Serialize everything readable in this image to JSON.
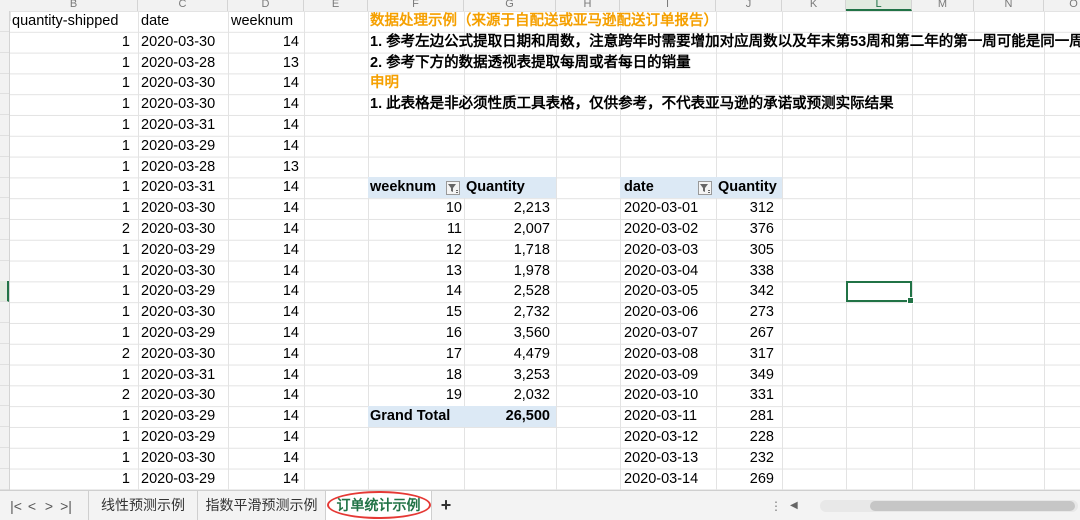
{
  "columns": [
    "B",
    "C",
    "D",
    "E",
    "F",
    "G",
    "H",
    "I",
    "J",
    "K",
    "L",
    "M",
    "N",
    "O"
  ],
  "selected_column": "L",
  "source_table": {
    "headers": [
      "quantity-shipped",
      "date",
      "weeknum"
    ],
    "rows": [
      [
        "1",
        "2020-03-30",
        "14"
      ],
      [
        "1",
        "2020-03-28",
        "13"
      ],
      [
        "1",
        "2020-03-30",
        "14"
      ],
      [
        "1",
        "2020-03-30",
        "14"
      ],
      [
        "1",
        "2020-03-31",
        "14"
      ],
      [
        "1",
        "2020-03-29",
        "14"
      ],
      [
        "1",
        "2020-03-28",
        "13"
      ],
      [
        "1",
        "2020-03-31",
        "14"
      ],
      [
        "1",
        "2020-03-30",
        "14"
      ],
      [
        "2",
        "2020-03-30",
        "14"
      ],
      [
        "1",
        "2020-03-29",
        "14"
      ],
      [
        "1",
        "2020-03-30",
        "14"
      ],
      [
        "1",
        "2020-03-29",
        "14"
      ],
      [
        "1",
        "2020-03-30",
        "14"
      ],
      [
        "1",
        "2020-03-29",
        "14"
      ],
      [
        "2",
        "2020-03-30",
        "14"
      ],
      [
        "1",
        "2020-03-31",
        "14"
      ],
      [
        "2",
        "2020-03-30",
        "14"
      ],
      [
        "1",
        "2020-03-29",
        "14"
      ],
      [
        "1",
        "2020-03-29",
        "14"
      ],
      [
        "1",
        "2020-03-30",
        "14"
      ],
      [
        "1",
        "2020-03-29",
        "14"
      ]
    ]
  },
  "notes": {
    "title": "数据处理示例（来源于自配送或亚马逊配送订单报告）",
    "line1": "1. 参考左边公式提取日期和周数，注意跨年时需要增加对应周数以及年末第53周和第二年的第一周可能是同一周",
    "line2": "2. 参考下方的数据透视表提取每周或者每日的销量",
    "disclaimer_title": "申明",
    "disclaimer_line1": "1. 此表格是非必须性质工具表格，仅供参考，不代表亚马逊的承诺或预测实际结果"
  },
  "pivot_week": {
    "headers": [
      "weeknum",
      "Quantity"
    ],
    "rows": [
      [
        "10",
        "2,213"
      ],
      [
        "11",
        "2,007"
      ],
      [
        "12",
        "1,718"
      ],
      [
        "13",
        "1,978"
      ],
      [
        "14",
        "2,528"
      ],
      [
        "15",
        "2,732"
      ],
      [
        "16",
        "3,560"
      ],
      [
        "17",
        "4,479"
      ],
      [
        "18",
        "3,253"
      ],
      [
        "19",
        "2,032"
      ]
    ],
    "total_label": "Grand Total",
    "total_value": "26,500"
  },
  "pivot_date": {
    "headers": [
      "date",
      "Quantity"
    ],
    "rows": [
      [
        "2020-03-01",
        "312"
      ],
      [
        "2020-03-02",
        "376"
      ],
      [
        "2020-03-03",
        "305"
      ],
      [
        "2020-03-04",
        "338"
      ],
      [
        "2020-03-05",
        "342"
      ],
      [
        "2020-03-06",
        "273"
      ],
      [
        "2020-03-07",
        "267"
      ],
      [
        "2020-03-08",
        "317"
      ],
      [
        "2020-03-09",
        "349"
      ],
      [
        "2020-03-10",
        "331"
      ],
      [
        "2020-03-11",
        "281"
      ],
      [
        "2020-03-12",
        "228"
      ],
      [
        "2020-03-13",
        "232"
      ],
      [
        "2020-03-14",
        "269"
      ]
    ]
  },
  "tabs": {
    "nav": [
      "|<",
      "<",
      ">",
      ">|"
    ],
    "sheets": [
      "线性预测示例",
      "指数平滑预测示例",
      "订单统计示例"
    ],
    "active_index": 2,
    "add_label": "+"
  },
  "colors": {
    "accent": "#217346",
    "orange": "#f5a000",
    "pivot_header_bg": "#dce9f5",
    "annotation_red": "#e53935"
  }
}
